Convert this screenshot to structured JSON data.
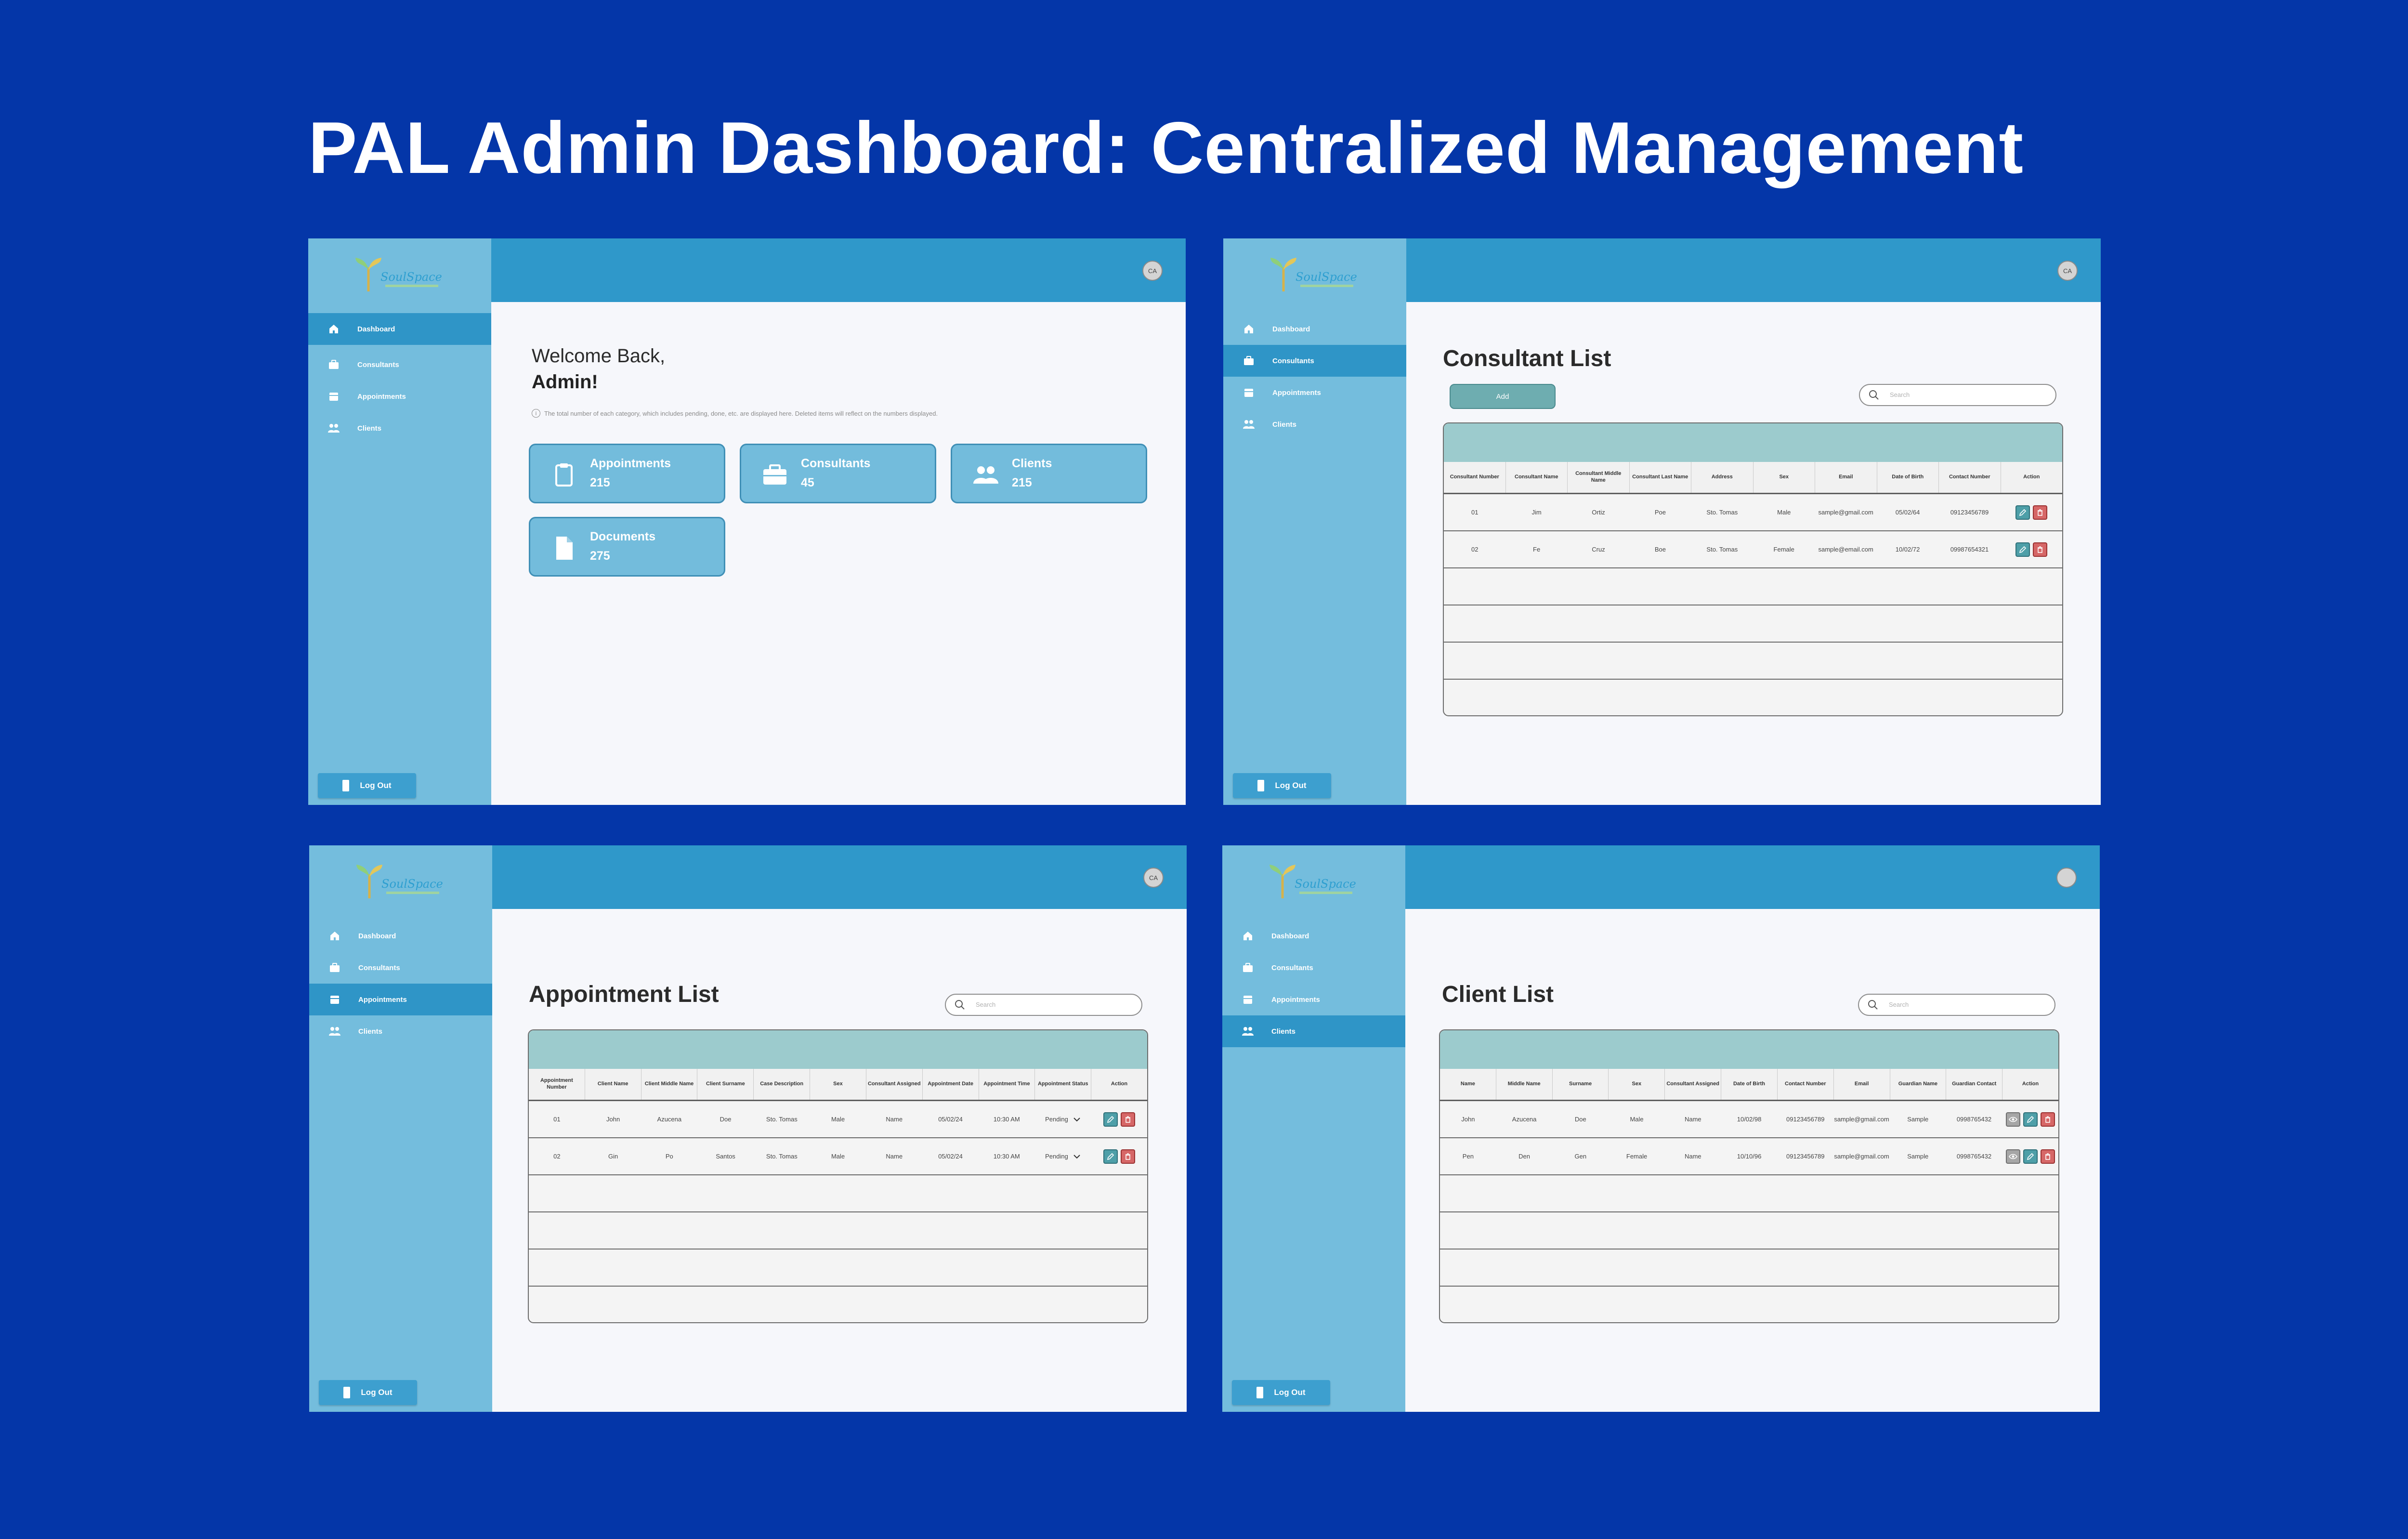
{
  "title": "PAL Admin Dashboard: Centralized Management",
  "brand": {
    "logo_text": "SoulSpace",
    "avatar_initials": "CA"
  },
  "nav": {
    "dashboard": "Dashboard",
    "consultants": "Consultants",
    "appointments": "Appointments",
    "clients": "Clients",
    "logout": "Log Out"
  },
  "dashboard": {
    "welcome": "Welcome Back,",
    "name": "Admin!",
    "info": "The total number of each category, which includes pending, done, etc. are displayed here. Deleted items will reflect on the numbers displayed.",
    "cards": [
      {
        "label": "Appointments",
        "value": "215",
        "icon": "clipboard-icon"
      },
      {
        "label": "Consultants",
        "value": "45",
        "icon": "briefcase-icon"
      },
      {
        "label": "Clients",
        "value": "215",
        "icon": "users-icon"
      },
      {
        "label": "Documents",
        "value": "275",
        "icon": "document-icon"
      }
    ]
  },
  "consultant_list": {
    "title": "Consultant List",
    "add_label": "Add",
    "search_placeholder": "Search",
    "columns": [
      "Consultant Number",
      "Consultant Name",
      "Consultant Middle Name",
      "Consultant Last Name",
      "Address",
      "Sex",
      "Email",
      "Date of Birth",
      "Contact Number",
      "Action"
    ],
    "rows": [
      [
        "01",
        "Jim",
        "Ortiz",
        "Poe",
        "Sto. Tomas",
        "Male",
        "sample@gmail.com",
        "05/02/64",
        "09123456789"
      ],
      [
        "02",
        "Fe",
        "Cruz",
        "Boe",
        "Sto. Tomas",
        "Female",
        "sample@email.com",
        "10/02/72",
        "09987654321"
      ]
    ]
  },
  "appointment_list": {
    "title": "Appointment List",
    "search_placeholder": "Search",
    "columns": [
      "Appointment Number",
      "Client Name",
      "Client Middle Name",
      "Client Surname",
      "Case Description",
      "Sex",
      "Consultant Assigned",
      "Appointment Date",
      "Appointment Time",
      "Appointment Status",
      "Action"
    ],
    "rows": [
      [
        "01",
        "John",
        "Azucena",
        "Doe",
        "Sto. Tomas",
        "Male",
        "Name",
        "05/02/24",
        "10:30 AM",
        "Pending"
      ],
      [
        "02",
        "Gin",
        "Po",
        "Santos",
        "Sto. Tomas",
        "Male",
        "Name",
        "05/02/24",
        "10:30 AM",
        "Pending"
      ]
    ]
  },
  "client_list": {
    "title": "Client List",
    "search_placeholder": "Search",
    "columns": [
      "Name",
      "Middle Name",
      "Surname",
      "Sex",
      "Consultant Assigned",
      "Date of Birth",
      "Contact Number",
      "Email",
      "Guardian Name",
      "Guardian Contact",
      "Action"
    ],
    "rows": [
      [
        "John",
        "Azucena",
        "Doe",
        "Male",
        "Name",
        "10/02/98",
        "09123456789",
        "sample@gmail.com",
        "Sample",
        "0998765432"
      ],
      [
        "Pen",
        "Den",
        "Gen",
        "Female",
        "Name",
        "10/10/96",
        "09123456789",
        "sample@gmail.com",
        "Sample",
        "0998765432"
      ]
    ]
  },
  "colors": {
    "background": "#0436a8",
    "sidebar": "#74bddd",
    "topbar": "#2f98ca",
    "active_nav": "#2f95c7",
    "table_band": "#9ccbcd",
    "edit": "#4e9fa8",
    "delete": "#d66767"
  }
}
